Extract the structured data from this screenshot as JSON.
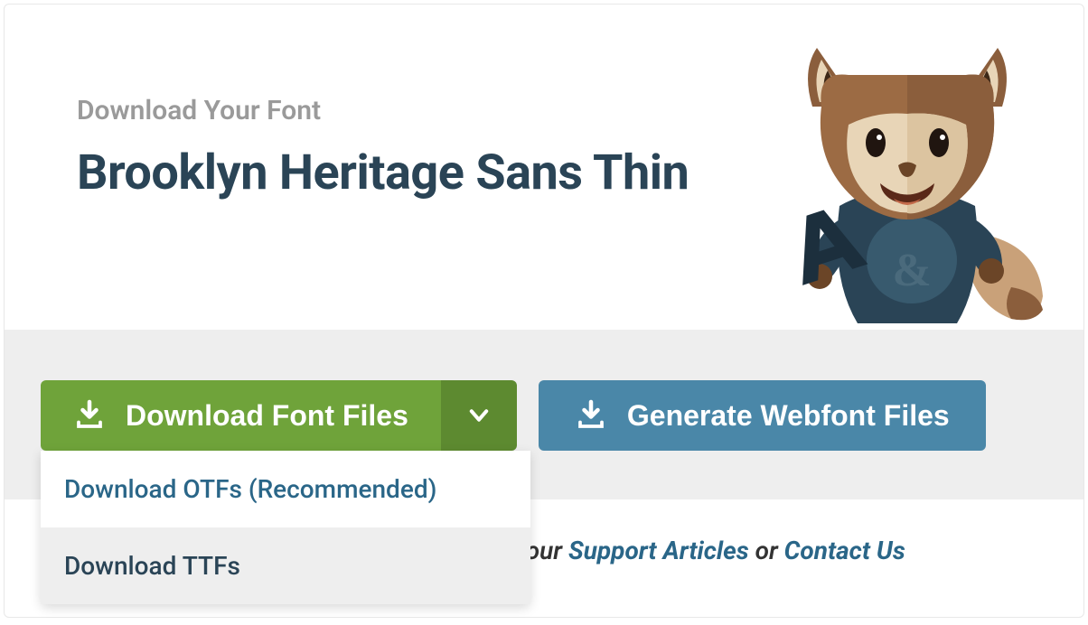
{
  "header": {
    "subtitle": "Download Your Font",
    "title": "Brooklyn Heritage Sans Thin"
  },
  "buttons": {
    "download_font_files": "Download Font Files",
    "generate_webfont": "Generate Webfont Files"
  },
  "dropdown": {
    "items": [
      {
        "label": "Download OTFs (Recommended)",
        "hovered": false
      },
      {
        "label": "Download TTFs",
        "hovered": true
      }
    ]
  },
  "footer": {
    "partial_text": "ad our ",
    "link1": "Support Articles",
    "or_text": " or ",
    "link2": "Contact Us"
  }
}
